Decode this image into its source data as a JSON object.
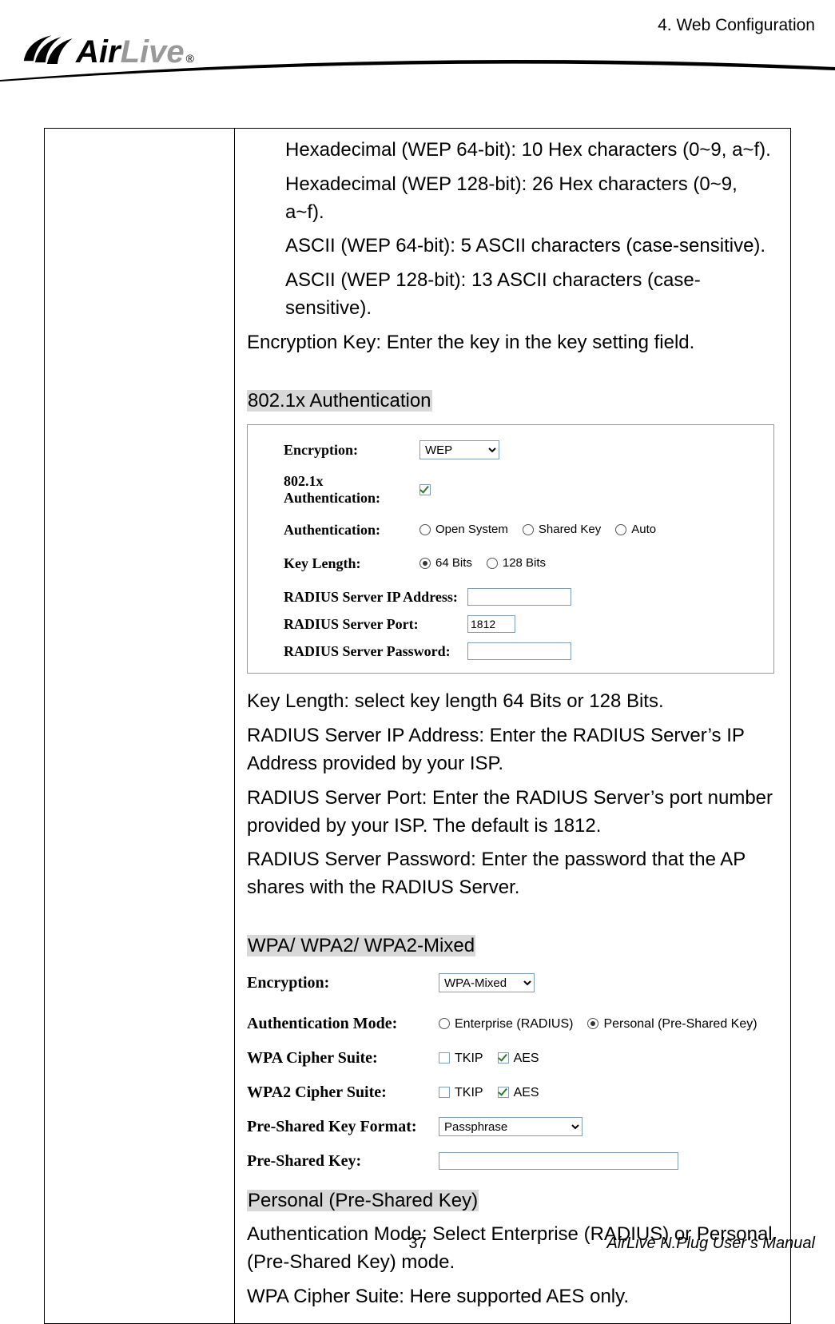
{
  "header": {
    "chapter": "4.  Web  Configuration"
  },
  "logo": {
    "air": "Air",
    "live": "Live",
    "reg": "®"
  },
  "body": {
    "hex64": "Hexadecimal (WEP 64-bit): 10 Hex characters (0~9, a~f).",
    "hex128": "Hexadecimal (WEP 128-bit): 26 Hex characters (0~9, a~f).",
    "ascii64": "ASCII (WEP 64-bit): 5 ASCII characters (case-sensitive).",
    "ascii128": "ASCII (WEP 128-bit): 13 ASCII characters (case-sensitive).",
    "enckey": "Encryption Key: Enter the key in the key setting field.",
    "sec_8021x": "802.1x Authentication",
    "keylen_text": "Key Length: select key length 64 Bits or 128 Bits.",
    "radius_ip_text": "RADIUS Server IP Address: Enter the RADIUS Server’s IP Address provided by your ISP.",
    "radius_port_text": "RADIUS Server Port: Enter the RADIUS Server’s port number provided by your ISP. The default is 1812.",
    "radius_pw_text": "RADIUS Server Password: Enter the password that the AP shares with the RADIUS Server.",
    "sec_wpa": "WPA/ WPA2/ WPA2-Mixed",
    "sec_personal": "Personal (Pre-Shared Key)",
    "authmode_text": "Authentication Mode: Select Enterprise (RADIUS) or Personal (Pre-Shared Key) mode.",
    "cipher_text": "WPA Cipher Suite: Here supported AES only."
  },
  "panel1": {
    "encryption_label": "Encryption:",
    "encryption_value": "WEP",
    "x8021_label": "802.1x Authentication:",
    "auth_label": "Authentication:",
    "auth_open": "Open System",
    "auth_shared": "Shared Key",
    "auth_auto": "Auto",
    "keylen_label": "Key Length:",
    "keylen_64": "64 Bits",
    "keylen_128": "128 Bits",
    "radius_ip_label": "RADIUS Server IP Address:",
    "radius_port_label": "RADIUS Server Port:",
    "radius_port_value": "1812",
    "radius_pw_label": "RADIUS Server Password:"
  },
  "panel2": {
    "encryption_label": "Encryption:",
    "encryption_value": "WPA-Mixed",
    "authmode_label": "Authentication Mode:",
    "authmode_ent": "Enterprise (RADIUS)",
    "authmode_personal": "Personal (Pre-Shared Key)",
    "wpa_cipher_label": "WPA Cipher Suite:",
    "wpa2_cipher_label": "WPA2 Cipher Suite:",
    "tkip": "TKIP",
    "aes": "AES",
    "psk_format_label": "Pre-Shared Key Format:",
    "psk_format_value": "Passphrase",
    "psk_label": "Pre-Shared Key:"
  },
  "footer": {
    "page": "37",
    "manual": "AirLive N.Plug User’s Manual"
  }
}
